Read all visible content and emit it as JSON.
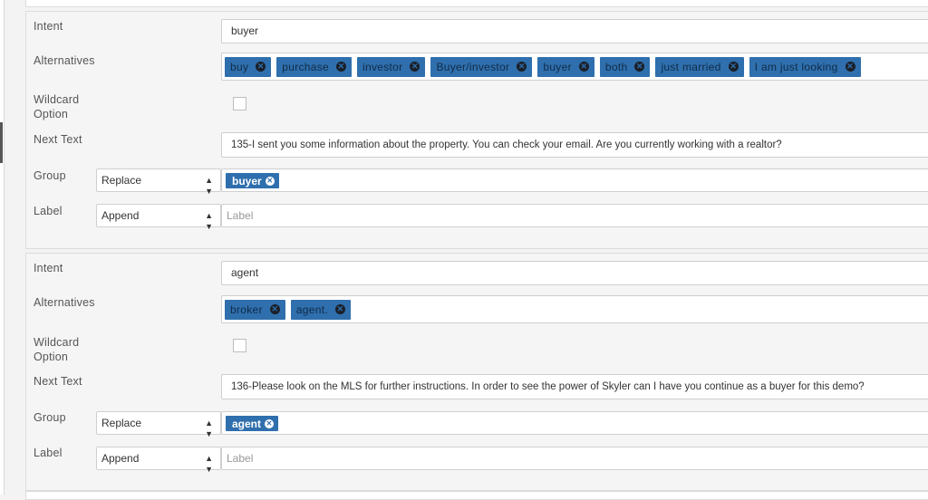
{
  "labels": {
    "intent": "Intent",
    "alternatives": "Alternatives",
    "wildcard_line1": "Wildcard",
    "wildcard_line2": "Option",
    "next_text": "Next Text",
    "group": "Group",
    "label": "Label"
  },
  "entries": [
    {
      "intent": "buyer",
      "alternatives": [
        "buy",
        "purchase",
        "investor",
        "Buyer/investor",
        "buyer",
        "both",
        "just married",
        "I am just looking"
      ],
      "wildcard_checked": false,
      "next_text": "135-I sent you some information about the property. You can check your email. Are you currently working with a realtor?",
      "group_mode": "Replace",
      "group_tag": "buyer",
      "label_mode": "Append",
      "label_placeholder": "Label"
    },
    {
      "intent": "agent",
      "alternatives": [
        "broker",
        "agent."
      ],
      "wildcard_checked": false,
      "next_text": "136-Please look on the MLS for further instructions. In order to see the power of Skyler can I have you continue as a buyer for this demo?",
      "group_mode": "Replace",
      "group_tag": "agent",
      "label_mode": "Append",
      "label_placeholder": "Label"
    }
  ],
  "icons": {
    "tag_remove": "remove-tag-icon",
    "select_caret": "sort-caret-icon"
  },
  "colors": {
    "tag_bg": "#2f6fad",
    "panel_bg": "#f5f5f5"
  }
}
